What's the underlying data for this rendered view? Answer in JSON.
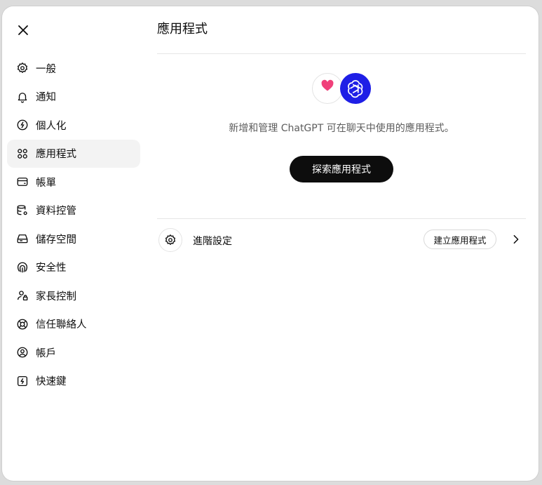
{
  "window": {
    "close_icon": "close-icon"
  },
  "sidebar": {
    "items": [
      {
        "label": "一般",
        "icon": "gear-icon",
        "active": false
      },
      {
        "label": "通知",
        "icon": "bell-icon",
        "active": false
      },
      {
        "label": "個人化",
        "icon": "personalize-icon",
        "active": false
      },
      {
        "label": "應用程式",
        "icon": "apps-grid-icon",
        "active": true
      },
      {
        "label": "帳單",
        "icon": "wallet-icon",
        "active": false
      },
      {
        "label": "資料控管",
        "icon": "database-gear-icon",
        "active": false
      },
      {
        "label": "儲存空間",
        "icon": "storage-icon",
        "active": false
      },
      {
        "label": "安全性",
        "icon": "fingerprint-icon",
        "active": false
      },
      {
        "label": "家長控制",
        "icon": "user-lock-icon",
        "active": false
      },
      {
        "label": "信任聯絡人",
        "icon": "lifebuoy-icon",
        "active": false
      },
      {
        "label": "帳戶",
        "icon": "user-circle-icon",
        "active": false
      },
      {
        "label": "快速鍵",
        "icon": "bolt-icon",
        "active": false
      }
    ]
  },
  "main": {
    "title": "應用程式",
    "description": "新增和管理 ChatGPT 可在聊天中使用的應用程式。",
    "explore_button": "探索應用程式",
    "advanced": {
      "label": "進階設定",
      "create_button": "建立應用程式"
    }
  },
  "colors": {
    "accent_dark": "#0d0d0d",
    "openai_logo_bg": "#1f1fe6",
    "heart": "#f0407a",
    "active_bg": "#f3f3f3"
  }
}
